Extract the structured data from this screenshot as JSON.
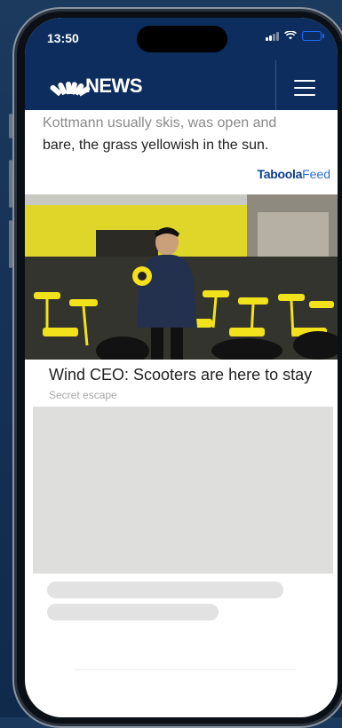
{
  "status_bar": {
    "time": "13:50"
  },
  "header": {
    "brand": "NEWS",
    "colors": {
      "bar": "#0c2d5e",
      "battery": "#1e6bff"
    }
  },
  "article": {
    "line1": "Kottmann usually skis, was open and",
    "line2": "bare, the grass yellowish in the sun."
  },
  "feed": {
    "provider_brand": "Taboola",
    "provider_suffix": "Feed",
    "items": [
      {
        "headline": "Wind CEO: Scooters are here to stay",
        "source": "Secret escape"
      }
    ]
  },
  "icons": [
    "peacock-logo-icon",
    "hamburger-menu-icon",
    "signal-icon",
    "wifi-icon",
    "battery-icon"
  ]
}
